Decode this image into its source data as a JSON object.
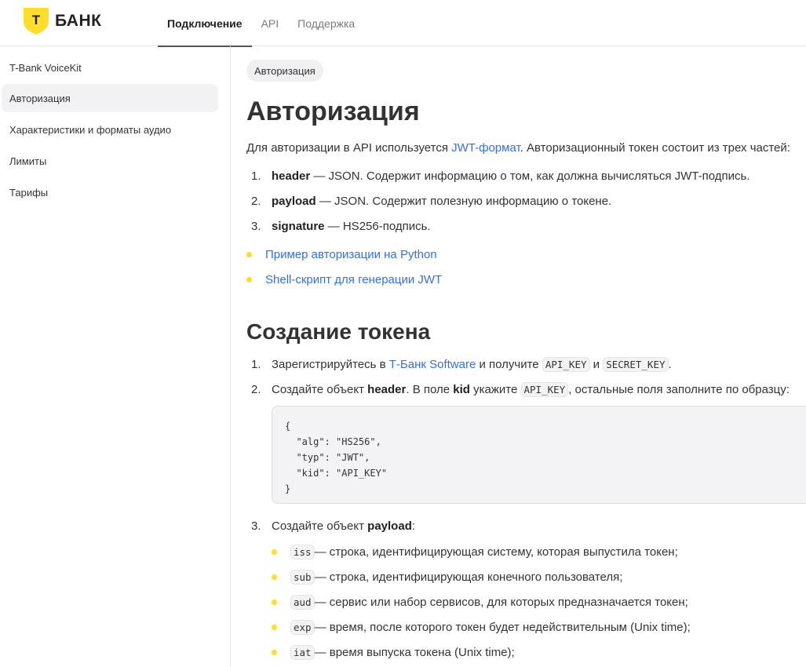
{
  "header": {
    "logo_text": "БАНК",
    "logo_letter": "Т",
    "nav": [
      "Подключение",
      "API",
      "Поддержка"
    ]
  },
  "sidebar": {
    "items": [
      {
        "label": "T-Bank VoiceKit"
      },
      {
        "label": "Авторизация",
        "active": true
      },
      {
        "label": "Характеристики и форматы аудио"
      },
      {
        "label": "Лимиты"
      },
      {
        "label": "Тарифы"
      }
    ]
  },
  "main": {
    "breadcrumb": "Авторизация",
    "title": "Авторизация",
    "intro_before": "Для авторизации в API используется ",
    "intro_link": "JWT-формат",
    "intro_after": ". Авторизационный токен состоит из трех частей:",
    "parts": [
      {
        "num": "1.",
        "name": "header",
        "text": " — JSON. Содержит информацию о том, как должна вычисляться JWT-подпись."
      },
      {
        "num": "2.",
        "name": "payload",
        "text": " — JSON. Содержит полезную информацию о токене."
      },
      {
        "num": "3.",
        "name": "signature",
        "text": " — HS256-подпись."
      }
    ],
    "links": [
      "Пример авторизации на Python",
      "Shell-скрипт для генерации JWT"
    ],
    "section_title": "Создание токена",
    "steps": {
      "s1_num": "1.",
      "s1_a": "Зарегистрируйтесь в ",
      "s1_link": "Т-Банк Software",
      "s1_b": " и получите ",
      "s1_code1": "API_KEY",
      "s1_c": " и ",
      "s1_code2": "SECRET_KEY",
      "s1_d": ".",
      "s2_num": "2.",
      "s2_a": "Создайте объект ",
      "s2_b": "header",
      "s2_c": ". В поле ",
      "s2_d": "kid",
      "s2_e": " укажите ",
      "s2_code": "API_KEY",
      "s2_f": ", остальные поля заполните по образцу:",
      "code_block": "{\n  \"alg\": \"HS256\",\n  \"typ\": \"JWT\",\n  \"kid\": \"API_KEY\"\n}",
      "s3_num": "3.",
      "s3_a": "Создайте объект ",
      "s3_b": "payload",
      "s3_c": ":"
    },
    "payload_fields": [
      {
        "code": "iss",
        "text": " — строка, идентифицирующая систему, которая выпустила токен;"
      },
      {
        "code": "sub",
        "text": " — строка, идентифицирующая конечного пользователя;"
      },
      {
        "code": "aud",
        "text": " — сервис или набор сервисов, для которых предназначается токен;"
      },
      {
        "code": "exp",
        "text": " — время, после которого токен будет недействительным (Unix time);"
      },
      {
        "code": "iat",
        "text": " — время выпуска токена (Unix time);"
      }
    ]
  },
  "colors": {
    "accent_yellow": "#ffdd2d",
    "link": "#336fee"
  }
}
